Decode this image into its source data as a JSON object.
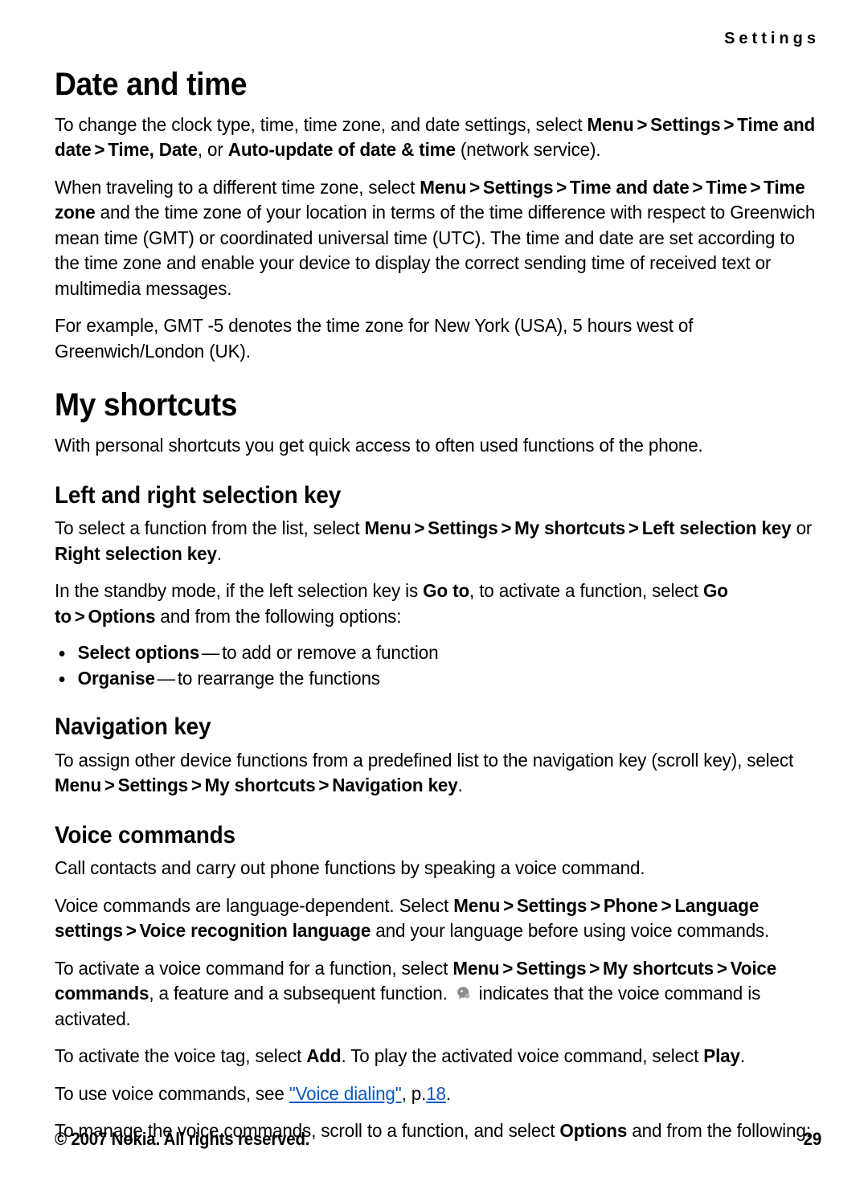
{
  "header": {
    "running_head": "Settings"
  },
  "sections": [
    {
      "id": "date-and-time",
      "heading": "Date and time",
      "level": 1
    },
    {
      "id": "my-shortcuts",
      "heading": "My shortcuts",
      "level": 1
    },
    {
      "id": "left-and-right-selection-key",
      "heading": "Left and right selection key",
      "level": 2
    },
    {
      "id": "navigation-key",
      "heading": "Navigation key",
      "level": 2
    },
    {
      "id": "voice-commands",
      "heading": "Voice commands",
      "level": 2
    }
  ],
  "paragraphs": {
    "p1": {
      "t1": "To change the clock type, time, time zone, and date settings, select ",
      "b1": "Menu",
      "gt1": ">",
      "b2": "Settings",
      "gt2": ">",
      "b3": "Time and date",
      "gt3": ">",
      "b4": "Time, Date",
      "t2": ", or ",
      "b5": "Auto-update of date & time",
      "t3": " (network service)."
    },
    "p2": {
      "t1": "When traveling to a different time zone, select ",
      "b1": "Menu",
      "gt1": ">",
      "b2": "Settings",
      "gt2": ">",
      "b3": "Time and date",
      "gt3": ">",
      "b4": "Time",
      "gt4": ">",
      "b5": "Time zone",
      "t2": " and the time zone of your location in terms of the time difference with respect to Greenwich mean time (GMT) or coordinated universal time (UTC). The time and date are set according to the time zone and enable your device to display the correct sending time of received text or multimedia messages."
    },
    "p3": {
      "t1": "For example, GMT -5 denotes the time zone for New York (USA), 5 hours west of Greenwich/London (UK)."
    },
    "p4": {
      "t1": "With personal shortcuts you get quick access to often used functions of the phone."
    },
    "p5": {
      "t1": "To select a function from the list, select ",
      "b1": "Menu",
      "gt1": ">",
      "b2": "Settings",
      "gt2": ">",
      "b3": "My shortcuts",
      "gt3": ">",
      "b4": "Left selection key",
      "t2": " or ",
      "b5": "Right selection key",
      "t3": "."
    },
    "p6": {
      "t1": "In the standby mode, if the left selection key is ",
      "b1": "Go to",
      "t2": ", to activate a function, select ",
      "b2": "Go to",
      "gt1": ">",
      "b3": "Options",
      "t3": " and from the following options:"
    },
    "p7": {
      "t1": "To assign other device functions from a predefined list to the navigation key (scroll key), select ",
      "b1": "Menu",
      "gt1": ">",
      "b2": "Settings",
      "gt2": ">",
      "b3": "My shortcuts",
      "gt3": ">",
      "b4": "Navigation key",
      "t2": "."
    },
    "p8": {
      "t1": "Call contacts and carry out phone functions by speaking a voice command."
    },
    "p9": {
      "t1": "Voice commands are language-dependent. Select ",
      "b1": "Menu",
      "gt1": ">",
      "b2": "Settings",
      "gt2": ">",
      "b3": "Phone",
      "gt3": ">",
      "b4": "Language settings",
      "gt4": ">",
      "b5": "Voice recognition language",
      "t2": " and your language before using voice commands."
    },
    "p10": {
      "t1": "To activate a voice command for a function, select ",
      "b1": "Menu",
      "gt1": ">",
      "b2": "Settings",
      "gt2": ">",
      "b3": "My shortcuts",
      "gt3": ">",
      "b4": "Voice commands",
      "t2": ", a feature and a subsequent function. ",
      "icon": "voice-command-indicator-icon",
      "t3": " indicates that the voice command is activated."
    },
    "p11": {
      "t1": "To activate the voice tag, select ",
      "b1": "Add",
      "t2": ". To play the activated voice command, select ",
      "b2": "Play",
      "t3": "."
    },
    "p12": {
      "t1": "To use voice commands, see ",
      "link_text": "\"Voice dialing\"",
      "t2": ", p.",
      "link_page": "18",
      "t3": "."
    },
    "p13": {
      "t1": "To manage the voice commands, scroll to a function, and select ",
      "b1": "Options",
      "t2": " and from the following:"
    }
  },
  "bullets": [
    {
      "label": "Select options",
      "dash": "—",
      "text": "to add or remove a function"
    },
    {
      "label": "Organise",
      "dash": "—",
      "text": "to rearrange the functions"
    }
  ],
  "footer": {
    "copyright": "© 2007 Nokia. All rights reserved.",
    "page_number": "29"
  },
  "colors": {
    "text": "#000000",
    "link": "#0b57c0",
    "background": "#ffffff",
    "icon_gray": "#8c8c8c"
  }
}
